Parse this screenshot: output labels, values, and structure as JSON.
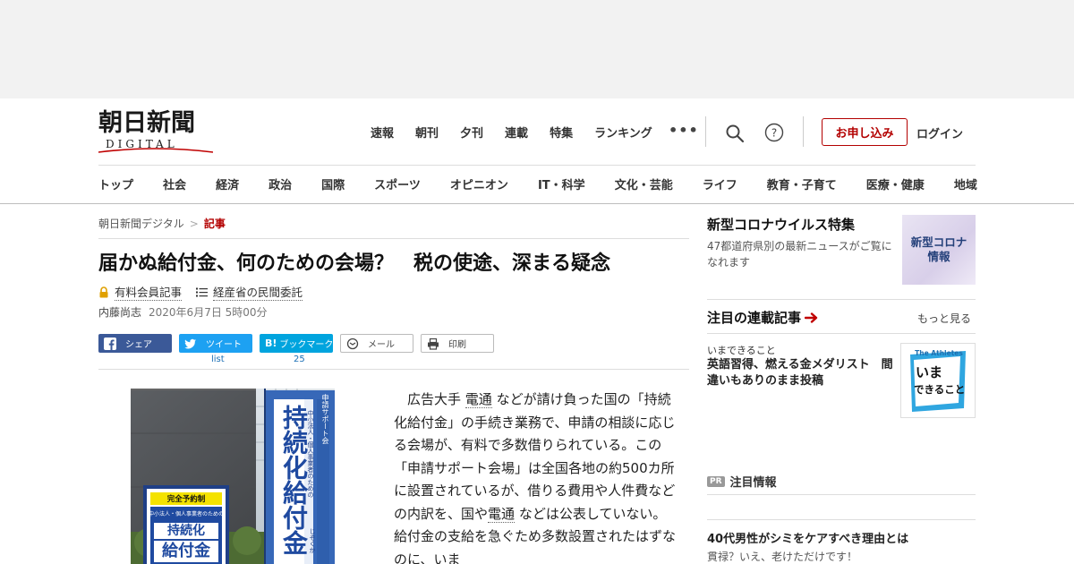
{
  "logo": {
    "main": "朝日新聞",
    "sub": "DIGITAL"
  },
  "topnav": [
    "速報",
    "朝刊",
    "夕刊",
    "連載",
    "特集",
    "ランキング"
  ],
  "more_dots": "•••",
  "header": {
    "apply_label": "お申し込み",
    "login_label": "ログイン"
  },
  "catnav": [
    "トップ",
    "社会",
    "経済",
    "政治",
    "国際",
    "スポーツ",
    "オピニオン",
    "IT・科学",
    "文化・芸能",
    "ライフ",
    "教育・子育て",
    "医療・健康",
    "地域"
  ],
  "breadcrumb": {
    "home": "朝日新聞デジタル",
    "sep": ">",
    "current": "記事"
  },
  "article": {
    "title": "届かぬ給付金、何のための会場？　税の使途、深まる疑念",
    "paid_tag": "有料会員記事",
    "series_tag": "経産省の民間委託",
    "author": "内藤尚志",
    "date": "2020年6月7日 5時00分",
    "body_1": "　広告大手",
    "body_dentsu_1": "電通",
    "body_2": "などが請け負った国の「持続化給付金」の手続き業務で、申請の相談に応じる会場が、有料で多数借りられている。この「申請サポート会場」は全国各地の約500カ所に設置されているが、借りる費用や人件費などの内訳を、国や",
    "body_dentsu_2": "電通",
    "body_3": "などは公表していない。給付金の支給を急ぐため多数設置されたはずなのに、いま"
  },
  "share": {
    "facebook": "シェア",
    "twitter": "ツイート",
    "hatena": "ブックマーク",
    "mail": "メール",
    "print": "印刷",
    "twitter_count": "list",
    "hatena_count": "25"
  },
  "photo": {
    "banner": "持続化給付金",
    "banner_side": "申請サポート会",
    "banner_small": "中小法人・個人事業者のための",
    "banner_lower": "じぞくか",
    "sign_top": "完全予約制",
    "sign_small": "中小法人・個人事業者のための",
    "sign_line1": "持続化",
    "sign_line2": "給付金"
  },
  "sidebar": {
    "corona_title": "新型コロナウイルス特集",
    "corona_desc": "47都道府県別の最新ニュースがご覧になれます",
    "corona_thumb_1": "新型コロナ",
    "corona_thumb_2": "情報",
    "series_head": "注目の連載記事",
    "see_more": "もっと見る",
    "series_name": "いまできること",
    "series_article": "英語習得、燃える金メダリスト　間違いもありのまま投稿",
    "athletic_top": "The Athletes",
    "athletic_1": "いま",
    "athletic_2": "できること",
    "pr_badge": "PR",
    "pr_title": "注目情報",
    "pr_article": "40代男性がシミをケアすべき理由とは",
    "pr_sub": "貫禄？いえ、老けただけです！"
  },
  "colors": {
    "accent": "#b30000",
    "facebook": "#3b5998",
    "twitter": "#1da1f2",
    "hatena": "#00a4de",
    "link": "#1a6fb5"
  }
}
